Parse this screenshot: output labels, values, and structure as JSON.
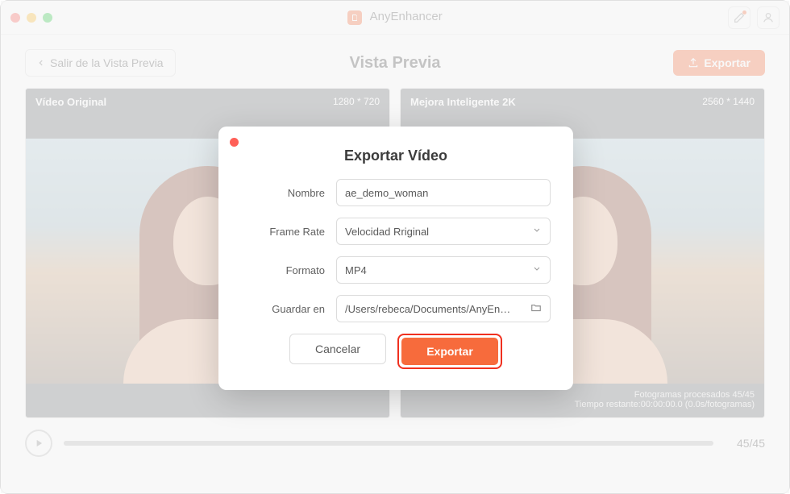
{
  "app": {
    "name": "AnyEnhancer"
  },
  "toolbar": {
    "back_label": "Salir de la Vista Previa",
    "page_title": "Vista Previa",
    "export_label": "Exportar"
  },
  "panes": {
    "left": {
      "title": "Vídeo Original",
      "resolution": "1280 * 720"
    },
    "right": {
      "title": "Mejora Inteligente 2K",
      "resolution": "2560 * 1440",
      "line1": "Fotogramas procesados 45/45",
      "line2": "Tiempo restante:00:00:00.0 (0.0s/fotogramas)"
    }
  },
  "scrub": {
    "position": "45/45"
  },
  "modal": {
    "title": "Exportar Vídeo",
    "labels": {
      "name": "Nombre",
      "fps": "Frame Rate",
      "format": "Formato",
      "save": "Guardar en"
    },
    "name_value": "ae_demo_woman",
    "fps_value": "Velocidad Rriginal",
    "format_value": "MP4",
    "save_path": "/Users/rebeca/Documents/AnyEnh…",
    "cancel": "Cancelar",
    "export": "Exportar"
  }
}
